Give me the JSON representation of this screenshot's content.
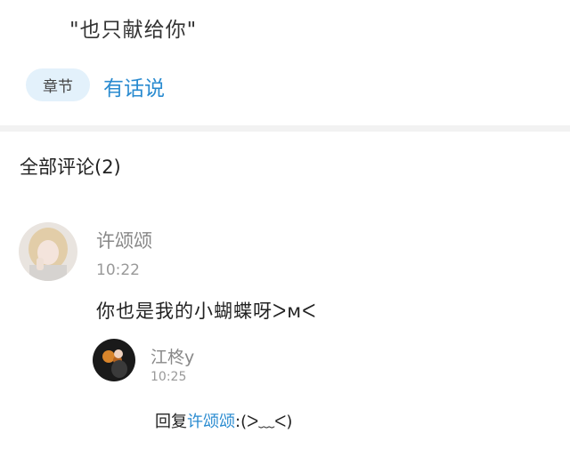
{
  "header": {
    "quote": "\"也只献给你\"",
    "chapter_chip": "章节",
    "talk_link": "有话说"
  },
  "comments_section": {
    "title": "全部评论(2)"
  },
  "comment": {
    "author": "许颂颂",
    "time": "10:22",
    "text": "你也是我的小蝴蝶呀ᐳмᐸ"
  },
  "reply": {
    "author": "江柊y",
    "time": "10:25",
    "prefix": "回复",
    "mention": "许颂颂",
    "text": ":(ᐳ﹏ᐸ)"
  },
  "colors": {
    "accent": "#2a8bd0",
    "chip_bg": "#e3f1fb",
    "divider": "#f2f2f2",
    "muted": "#888888"
  }
}
